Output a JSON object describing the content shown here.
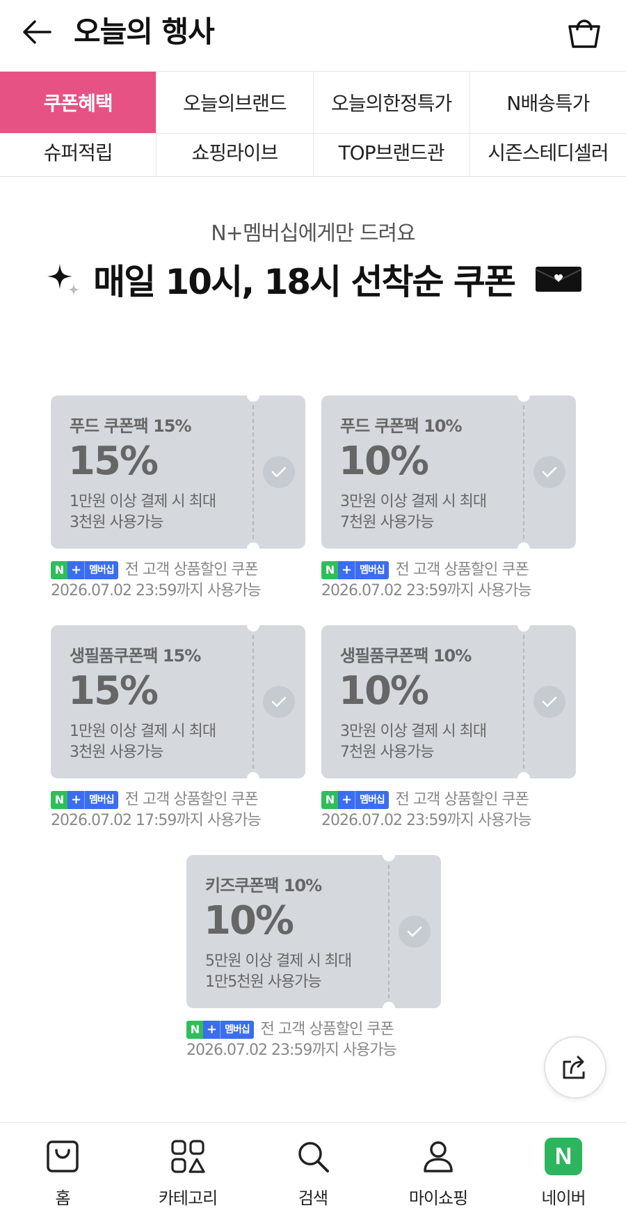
{
  "header": {
    "title": "오늘의 행사",
    "back_icon": "arrow-left-icon",
    "cart_icon": "shopping-bag-icon"
  },
  "tabs": {
    "row1": [
      "쿠폰혜택",
      "오늘의브랜드",
      "오늘의한정특가",
      "N배송특가"
    ],
    "row2": [
      "슈퍼적립",
      "쇼핑라이브",
      "TOP브랜드관",
      "시즌스테디셀러"
    ],
    "active": "쿠폰혜택",
    "active_color": "#e65284"
  },
  "promo": {
    "subtitle": "N+멤버십에게만 드려요",
    "title": "매일 10시, 18시 선착순 쿠폰"
  },
  "badge": {
    "n": "N",
    "plus": "+",
    "membership": "멤버십"
  },
  "coupons": [
    {
      "name": "푸드 쿠폰팩 15%",
      "percent": "15%",
      "desc1": "1만원 이상 결제 시 최대",
      "desc2": "3천원 사용가능",
      "target": "전 고객 상품할인 쿠폰",
      "expiry": "2026.07.02 23:59까지 사용가능"
    },
    {
      "name": "푸드 쿠폰팩 10%",
      "percent": "10%",
      "desc1": "3만원 이상 결제 시 최대",
      "desc2": "7천원 사용가능",
      "target": "전 고객 상품할인 쿠폰",
      "expiry": "2026.07.02 23:59까지 사용가능"
    },
    {
      "name": "생필품쿠폰팩 15%",
      "percent": "15%",
      "desc1": "1만원 이상 결제 시 최대",
      "desc2": "3천원 사용가능",
      "target": "전 고객 상품할인 쿠폰",
      "expiry": "2026.07.02 17:59까지 사용가능"
    },
    {
      "name": "생필품쿠폰팩 10%",
      "percent": "10%",
      "desc1": "3만원 이상 결제 시 최대",
      "desc2": "7천원 사용가능",
      "target": "전 고객 상품할인 쿠폰",
      "expiry": "2026.07.02 23:59까지 사용가능"
    },
    {
      "name": "키즈쿠폰팩 10%",
      "percent": "10%",
      "desc1": "5만원 이상 결제 시 최대",
      "desc2": "1만5천원 사용가능",
      "target": "전 고객 상품할인 쿠폰",
      "expiry": "2026.07.02 23:59까지 사용가능"
    }
  ],
  "share_icon": "share-icon",
  "bottom_nav": [
    {
      "label": "홈",
      "icon": "home-bag-icon"
    },
    {
      "label": "카테고리",
      "icon": "category-icon"
    },
    {
      "label": "검색",
      "icon": "search-icon"
    },
    {
      "label": "마이쇼핑",
      "icon": "person-icon"
    },
    {
      "label": "네이버",
      "icon": "naver-logo-icon",
      "logo_text": "N"
    }
  ]
}
